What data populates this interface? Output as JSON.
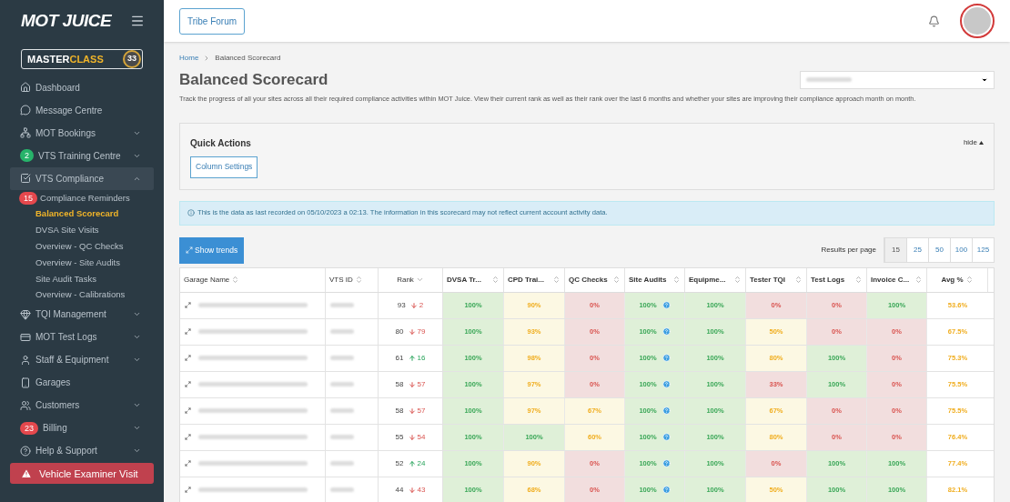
{
  "brand": {
    "logo": "MOT JUICE",
    "masterclass": {
      "main": "MASTER",
      "accent": "CLASS",
      "count": "33"
    }
  },
  "sidebar": {
    "items": [
      {
        "label": "Dashboard",
        "selected": false,
        "has_chevron": false
      },
      {
        "label": "Message Centre",
        "selected": false,
        "has_chevron": false
      },
      {
        "label": "MOT Bookings",
        "selected": false,
        "expanded": false,
        "has_chevron": true
      },
      {
        "label": "VTS Training Centre",
        "selected": false,
        "expanded": false,
        "has_chevron": true,
        "badge": {
          "text": "2",
          "color": "#27b36a"
        }
      },
      {
        "label": "VTS Compliance",
        "selected": true,
        "expanded": true,
        "has_chevron": true,
        "children": [
          {
            "label": "Compliance Reminders",
            "selected": false,
            "badge": {
              "text": "15",
              "color": "#e5484d"
            }
          },
          {
            "label": "Balanced Scorecard",
            "selected": true
          },
          {
            "label": "DVSA Site Visits",
            "selected": false
          },
          {
            "label": "Overview - QC Checks",
            "selected": false
          },
          {
            "label": "Overview - Site Audits",
            "selected": false
          },
          {
            "label": "Site Audit Tasks",
            "selected": false
          },
          {
            "label": "Overview - Calibrations",
            "selected": false
          }
        ]
      },
      {
        "label": "TQI Management",
        "selected": false,
        "expanded": false,
        "has_chevron": true
      },
      {
        "label": "MOT Test Logs",
        "selected": false,
        "expanded": false,
        "has_chevron": true
      },
      {
        "label": "Staff & Equipment",
        "selected": false,
        "expanded": false,
        "has_chevron": true
      },
      {
        "label": "Garages",
        "selected": false,
        "has_chevron": false
      },
      {
        "label": "Customers",
        "selected": false,
        "expanded": false,
        "has_chevron": true
      },
      {
        "label": "Billing",
        "selected": false,
        "expanded": false,
        "has_chevron": true,
        "badge": {
          "text": "23",
          "color": "#e5484d"
        }
      },
      {
        "label": "Help & Support",
        "selected": false,
        "expanded": false,
        "has_chevron": true
      }
    ],
    "alert_button": "Vehicle Examiner Visit"
  },
  "topbar": {
    "forum_button": "Tribe Forum"
  },
  "breadcrumb": [
    "Home",
    "Balanced Scorecard"
  ],
  "page": {
    "title": "Balanced Scorecard",
    "description": "Track the progress of all your sites across all their required compliance activities within MOT Juice. View their current rank as well as their rank over the last 6 months and whether your sites are improving their compliance approach month on month."
  },
  "quick_actions": {
    "title": "Quick Actions",
    "toggle": "hide",
    "buttons": [
      "Column Settings"
    ]
  },
  "info_banner": "This is the data as last recorded on 05/10/2023 a 02:13. The information in this scorecard may not reflect current account activity data.",
  "trends_button": "Show trends",
  "pagination": {
    "label": "Results per page",
    "options": [
      {
        "label": "15",
        "selected": true
      },
      {
        "label": "25",
        "selected": false
      },
      {
        "label": "50",
        "selected": false
      },
      {
        "label": "100",
        "selected": false
      },
      {
        "label": "125",
        "selected": false
      }
    ]
  },
  "table": {
    "columns": [
      {
        "label": "Garage Name",
        "sorted_desc": false
      },
      {
        "label": "VTS ID",
        "sorted_desc": false
      },
      {
        "label": "Rank",
        "sorted_desc": true
      },
      {
        "label": "DVSA Tr...",
        "sorted_desc": false
      },
      {
        "label": "CPD Trai...",
        "sorted_desc": false
      },
      {
        "label": "QC Checks",
        "sorted_desc": false
      },
      {
        "label": "Site Audits",
        "sorted_desc": false
      },
      {
        "label": "Equipme...",
        "sorted_desc": false
      },
      {
        "label": "Tester TQI",
        "sorted_desc": false
      },
      {
        "label": "Test Logs",
        "sorted_desc": false
      },
      {
        "label": "Invoice C...",
        "sorted_desc": false
      },
      {
        "label": "Avg %",
        "sorted_desc": false
      }
    ],
    "rows": [
      {
        "rank": "93",
        "change": {
          "rising": false,
          "value": "2"
        },
        "scores": [
          {
            "text": "100%",
            "kind": "good",
            "help": false
          },
          {
            "text": "90%",
            "kind": "warn",
            "help": false
          },
          {
            "text": "0%",
            "kind": "bad",
            "help": false
          },
          {
            "text": "100%",
            "kind": "good",
            "help": true
          },
          {
            "text": "100%",
            "kind": "good",
            "help": false
          },
          {
            "text": "0%",
            "kind": "bad",
            "help": false
          },
          {
            "text": "0%",
            "kind": "bad",
            "help": false
          },
          {
            "text": "100%",
            "kind": "good",
            "help": false
          }
        ],
        "avg": "53.6%"
      },
      {
        "rank": "80",
        "change": {
          "rising": false,
          "value": "79"
        },
        "scores": [
          {
            "text": "100%",
            "kind": "good",
            "help": false
          },
          {
            "text": "93%",
            "kind": "warn",
            "help": false
          },
          {
            "text": "0%",
            "kind": "bad",
            "help": false
          },
          {
            "text": "100%",
            "kind": "good",
            "help": true
          },
          {
            "text": "100%",
            "kind": "good",
            "help": false
          },
          {
            "text": "50%",
            "kind": "warn",
            "help": false
          },
          {
            "text": "0%",
            "kind": "bad",
            "help": false
          },
          {
            "text": "0%",
            "kind": "bad",
            "help": false
          }
        ],
        "avg": "67.5%"
      },
      {
        "rank": "61",
        "change": {
          "rising": true,
          "value": "16"
        },
        "scores": [
          {
            "text": "100%",
            "kind": "good",
            "help": false
          },
          {
            "text": "98%",
            "kind": "warn",
            "help": false
          },
          {
            "text": "0%",
            "kind": "bad",
            "help": false
          },
          {
            "text": "100%",
            "kind": "good",
            "help": true
          },
          {
            "text": "100%",
            "kind": "good",
            "help": false
          },
          {
            "text": "80%",
            "kind": "warn",
            "help": false
          },
          {
            "text": "100%",
            "kind": "good",
            "help": false
          },
          {
            "text": "0%",
            "kind": "bad",
            "help": false
          }
        ],
        "avg": "75.3%"
      },
      {
        "rank": "58",
        "change": {
          "rising": false,
          "value": "57"
        },
        "scores": [
          {
            "text": "100%",
            "kind": "good",
            "help": false
          },
          {
            "text": "97%",
            "kind": "warn",
            "help": false
          },
          {
            "text": "0%",
            "kind": "bad",
            "help": false
          },
          {
            "text": "100%",
            "kind": "good",
            "help": true
          },
          {
            "text": "100%",
            "kind": "good",
            "help": false
          },
          {
            "text": "33%",
            "kind": "bad",
            "help": false
          },
          {
            "text": "100%",
            "kind": "good",
            "help": false
          },
          {
            "text": "0%",
            "kind": "bad",
            "help": false
          }
        ],
        "avg": "75.5%"
      },
      {
        "rank": "58",
        "change": {
          "rising": false,
          "value": "57"
        },
        "scores": [
          {
            "text": "100%",
            "kind": "good",
            "help": false
          },
          {
            "text": "97%",
            "kind": "warn",
            "help": false
          },
          {
            "text": "67%",
            "kind": "warn",
            "help": false
          },
          {
            "text": "100%",
            "kind": "good",
            "help": true
          },
          {
            "text": "100%",
            "kind": "good",
            "help": false
          },
          {
            "text": "67%",
            "kind": "warn",
            "help": false
          },
          {
            "text": "0%",
            "kind": "bad",
            "help": false
          },
          {
            "text": "0%",
            "kind": "bad",
            "help": false
          }
        ],
        "avg": "75.5%"
      },
      {
        "rank": "55",
        "change": {
          "rising": false,
          "value": "54"
        },
        "scores": [
          {
            "text": "100%",
            "kind": "good",
            "help": false
          },
          {
            "text": "100%",
            "kind": "good",
            "help": false
          },
          {
            "text": "60%",
            "kind": "warn",
            "help": false
          },
          {
            "text": "100%",
            "kind": "good",
            "help": true
          },
          {
            "text": "100%",
            "kind": "good",
            "help": false
          },
          {
            "text": "80%",
            "kind": "warn",
            "help": false
          },
          {
            "text": "0%",
            "kind": "bad",
            "help": false
          },
          {
            "text": "0%",
            "kind": "bad",
            "help": false
          }
        ],
        "avg": "76.4%"
      },
      {
        "rank": "52",
        "change": {
          "rising": true,
          "value": "24"
        },
        "scores": [
          {
            "text": "100%",
            "kind": "good",
            "help": false
          },
          {
            "text": "90%",
            "kind": "warn",
            "help": false
          },
          {
            "text": "0%",
            "kind": "bad",
            "help": false
          },
          {
            "text": "100%",
            "kind": "good",
            "help": true
          },
          {
            "text": "100%",
            "kind": "good",
            "help": false
          },
          {
            "text": "0%",
            "kind": "bad",
            "help": false
          },
          {
            "text": "100%",
            "kind": "good",
            "help": false
          },
          {
            "text": "100%",
            "kind": "good",
            "help": false
          }
        ],
        "avg": "77.4%"
      },
      {
        "rank": "44",
        "change": {
          "rising": false,
          "value": "43"
        },
        "scores": [
          {
            "text": "100%",
            "kind": "good",
            "help": false
          },
          {
            "text": "68%",
            "kind": "warn",
            "help": false
          },
          {
            "text": "0%",
            "kind": "bad",
            "help": false
          },
          {
            "text": "100%",
            "kind": "good",
            "help": true
          },
          {
            "text": "100%",
            "kind": "good",
            "help": false
          },
          {
            "text": "50%",
            "kind": "warn",
            "help": false
          },
          {
            "text": "100%",
            "kind": "good",
            "help": false
          },
          {
            "text": "100%",
            "kind": "good",
            "help": false
          }
        ],
        "avg": "82.1%"
      }
    ]
  }
}
